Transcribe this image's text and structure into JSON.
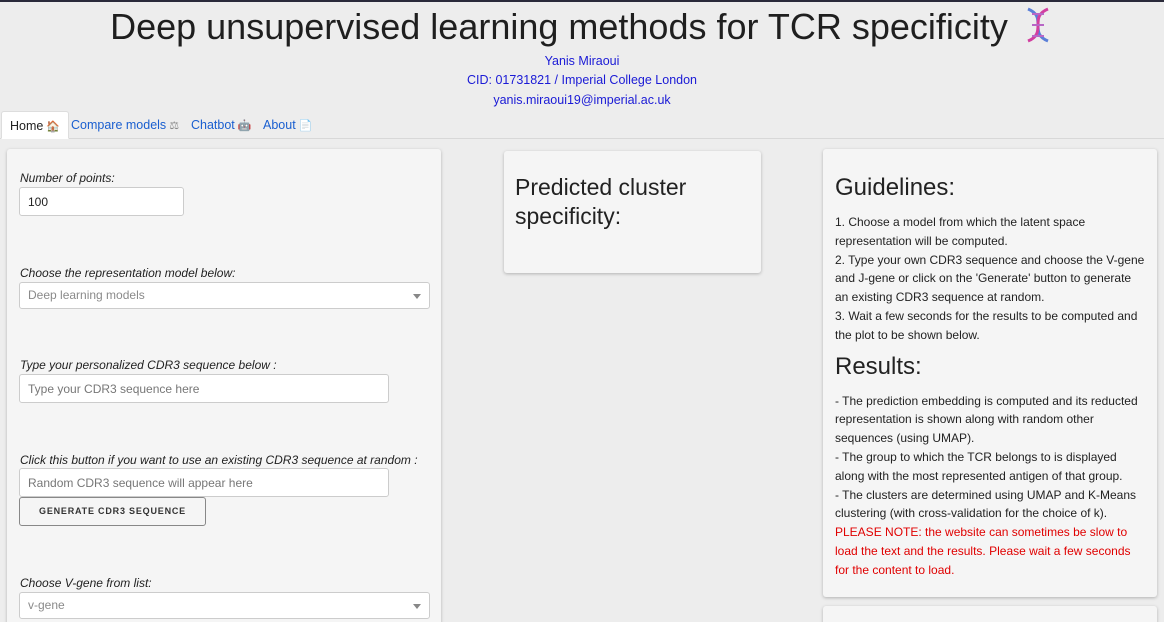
{
  "header": {
    "title": "Deep unsupervised learning methods for TCR specificity",
    "author": "Yanis Miraoui",
    "cid": "CID: 01731821 / Imperial College London",
    "email": "yanis.miraoui19@imperial.ac.uk"
  },
  "tabs": [
    {
      "label": "Home",
      "icon": "house-icon",
      "glyph": "🏠"
    },
    {
      "label": "Compare models",
      "icon": "scales-icon",
      "glyph": "⚖"
    },
    {
      "label": "Chatbot",
      "icon": "robot-icon",
      "glyph": "🤖"
    },
    {
      "label": "About",
      "icon": "page-icon",
      "glyph": "📄"
    }
  ],
  "form": {
    "num_points_label": "Number of points:",
    "num_points_value": "100",
    "model_label": "Choose the representation model below:",
    "model_placeholder": "Deep learning models",
    "cdr3_label": "Type your personalized CDR3 sequence below :",
    "cdr3_placeholder": "Type your CDR3 sequence here",
    "random_label": "Click this button if you want to use an existing CDR3 sequence at random :",
    "random_placeholder": "Random CDR3 sequence will appear here",
    "generate_button": "GENERATE CDR3 SEQUENCE",
    "vgene_label": "Choose V-gene from list:",
    "vgene_placeholder": "v-gene"
  },
  "prediction": {
    "title": "Predicted cluster specificity:"
  },
  "guidelines": {
    "title": "Guidelines:",
    "steps": [
      "1. Choose a model from which the latent space representation will be computed.",
      "2. Type your own CDR3 sequence and choose the V-gene and J-gene or click on the 'Generate' button to generate an existing CDR3 sequence at random.",
      "3. Wait a few seconds for the results to be computed and the plot to be shown below."
    ]
  },
  "results": {
    "title": "Results:",
    "points": [
      "- The prediction embedding is computed and its reducted representation is shown along with random other sequences (using UMAP).",
      "- The group to which the TCR belongs to is displayed along with the most represented antigen of that group.",
      "- The clusters are determined using UMAP and K-Means clustering (with cross-validation for the choice of k)."
    ],
    "note": "PLEASE NOTE: the website can sometimes be slow to load the text and the results. Please wait a few seconds for the content to load."
  },
  "colors": {
    "link": "#1a5fd0",
    "author": "#1a1ad6",
    "warning": "#e00000"
  }
}
